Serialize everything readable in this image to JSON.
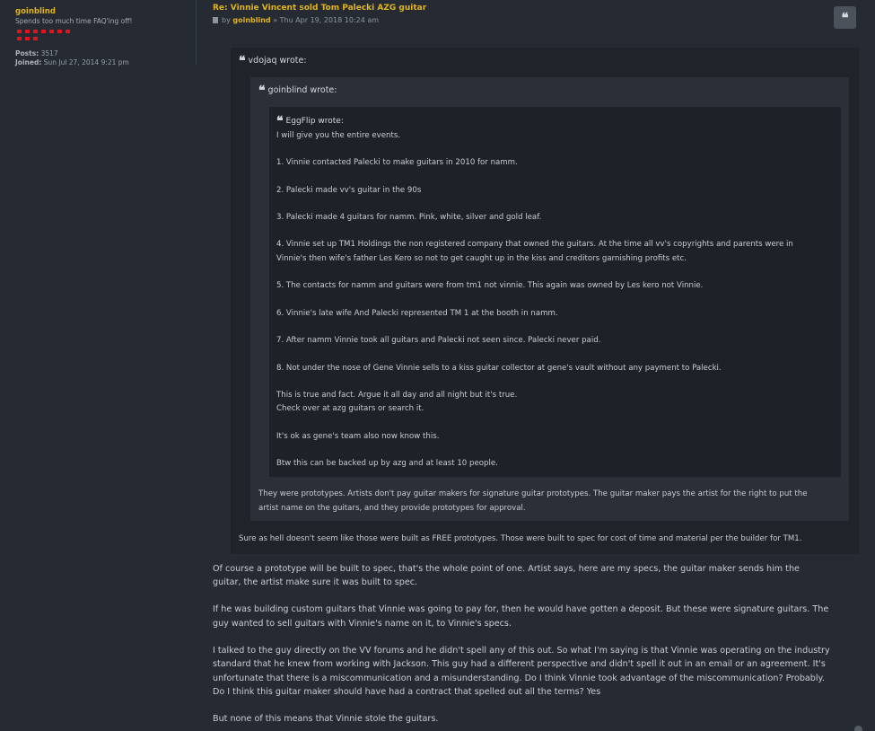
{
  "profile": {
    "username": "goinblind",
    "rank_title": "Spends too much time FAQ'ing off!",
    "posts_label": "Posts:",
    "posts_value": "3517",
    "joined_label": "Joined:",
    "joined_value": "Sun Jul 27, 2014 9:21 pm"
  },
  "post": {
    "title": "Re: Vinnie Vincent sold Tom Palecki AZG guitar",
    "by": "by",
    "author": "goinblind",
    "date": "» Thu Apr 19, 2018 10:24 am",
    "quote_button_glyph": "❝"
  },
  "quotes": {
    "outer_cite": "vdojaq wrote:",
    "middle_cite": "goinblind wrote:",
    "inner_cite": "EggFlip wrote:",
    "inner_lines": [
      "I will give you the entire events.",
      "1. Vinnie contacted Palecki to make guitars in 2010 for namm.",
      "2. Palecki made vv's guitar in the 90s",
      "3. Palecki made 4 guitars for namm. Pink, white, silver and gold leaf.",
      "4. Vinnie set up TM1 Holdings the non registered company that owned the guitars. At the time all vv's copyrights and parents were in",
      "Vinnie's then wife's father Les Kero so not to get caught up in the kiss and creditors garnishing profits etc.",
      "5. The contacts for namm and guitars were from tm1 not vinnie. This again was owned by Les kero not Vinnie.",
      "6. Vinnie's late wife And Palecki represented TM 1 at the booth in namm.",
      "7. After namm Vinnie took all guitars and Palecki not seen since. Palecki never paid.",
      "8. Not under the nose of Gene Vinnie sells to a kiss guitar collector at gene's vault without any payment to Palecki.",
      "This is true and fact. Argue it all day and all night but it's true.",
      "Check over at azg guitars or search it.",
      "It's ok as gene's team also now know this.",
      "Btw this can be backed up by azg and at least 10 people."
    ],
    "middle_lines": [
      "They were prototypes. Artists don't pay guitar makers for signature guitar prototypes. The guitar maker pays the artist for the right to put the",
      "artist name on the guitars, and they provide prototypes for approval."
    ],
    "outer_lines": [
      "Sure as hell doesn't seem like those were built as FREE prototypes. Those were built to spec for cost of time and material per the builder for TM1."
    ]
  },
  "body_lines": [
    "Of course a prototype will be built to spec, that's the whole point of one. Artist says, here are my specs, the guitar maker sends him the",
    "guitar, the artist make sure it was built to spec.",
    "If he was building custom guitars that Vinnie was going to pay for, then he would have gotten a deposit. But these were signature guitars. The",
    "guy wanted to sell guitars with Vinnie's name on it, to Vinnie's specs.",
    "I talked to the guy directly on the VV forums and he didn't spell any of this out. So what I'm saying is that Vinnie was operating on the industry",
    "standard that he knew from working with Jackson. This guy had a different perspective and didn't spell it out in an email or an agreement. It's",
    "unfortunate that there is a miscommunication and a misunderstanding. Do I think Vinnie took advantage of the miscommunication? Probably.",
    "Do I think this guitar maker should have had a contract that spelled out all the terms? Yes",
    "But none of this means that Vinnie stole the guitars."
  ],
  "colors": {
    "accent": "#e0b41c",
    "background": "#262b33",
    "rank_red": "#e0151b"
  }
}
